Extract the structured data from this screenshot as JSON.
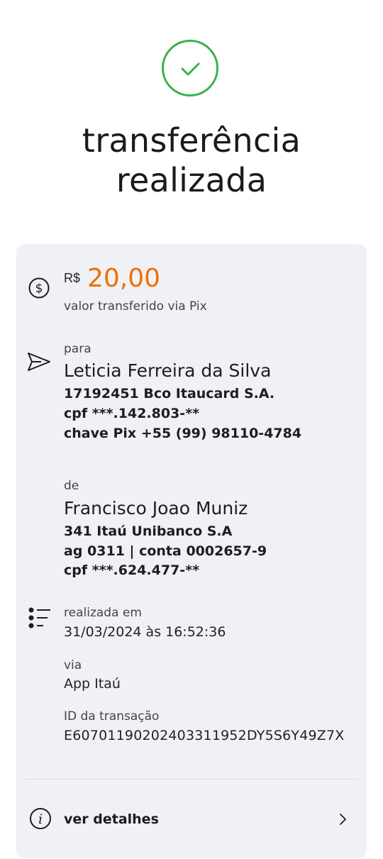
{
  "header": {
    "title_line1": "transferência",
    "title_line2": "realizada"
  },
  "amount": {
    "currency": "R$",
    "value": "20,00",
    "caption": "valor transferido via Pix"
  },
  "recipient": {
    "label": "para",
    "name": "Leticia Ferreira da Silva",
    "bank": "17192451 Bco Itaucard S.A.",
    "cpf": "cpf ***.142.803-**",
    "pix_key": "chave Pix +55 (99) 98110-4784"
  },
  "sender": {
    "label": "de",
    "name": "Francisco Joao Muniz",
    "bank": "341 Itaú Unibanco S.A",
    "account": "ag 0311 | conta 0002657-9",
    "cpf": "cpf ***.624.477-**"
  },
  "info": {
    "date_label": "realizada em",
    "date_value": "31/03/2024 às 16:52:36",
    "via_label": "via",
    "via_value": "App Itaú",
    "id_label": "ID da transação",
    "id_value": "E60701190202403311952DY5S6Y49Z7X"
  },
  "actions": {
    "details_label": "ver detalhes"
  },
  "colors": {
    "success": "#37b24d",
    "amount": "#ec7000",
    "card_bg": "#eff1f4"
  },
  "icons": [
    "check-icon",
    "dollar-icon",
    "send-icon",
    "list-icon",
    "info-icon",
    "chevron-right-icon"
  ]
}
